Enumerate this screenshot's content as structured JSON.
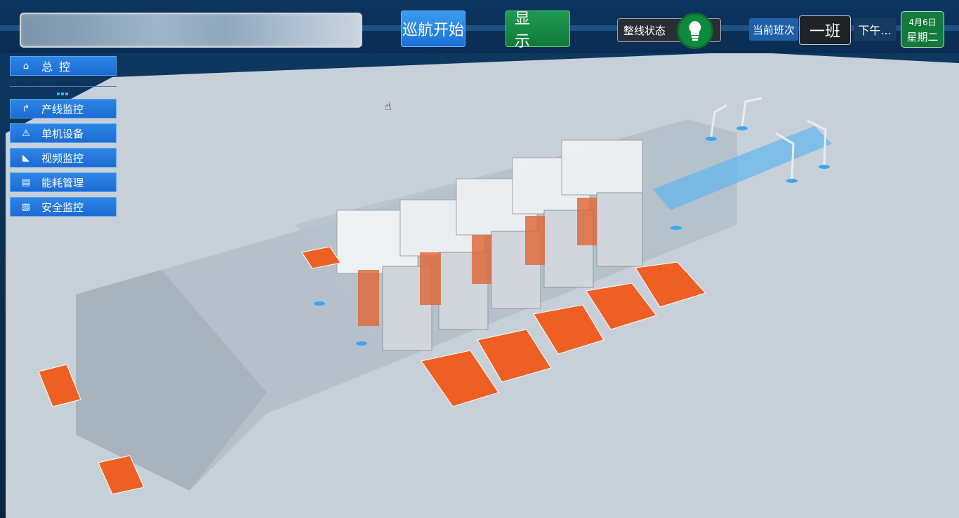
{
  "header": {
    "title": "",
    "cruise_button": "巡航开始",
    "display_button": "显 示",
    "line_status_label": "整线状态",
    "current_shift_label": "当前班次",
    "current_shift_value": "一班",
    "time_text": "下午...",
    "date": "4月6日",
    "weekday": "星期二"
  },
  "sidebar": {
    "items": [
      {
        "label": "总 控",
        "icon": "home-icon"
      },
      {
        "label": "产线监控",
        "icon": "production-line-icon"
      },
      {
        "label": "单机设备",
        "icon": "warning-icon"
      },
      {
        "label": "视频监控",
        "icon": "camera-icon"
      },
      {
        "label": "能耗管理",
        "icon": "document-icon"
      },
      {
        "label": "安全监控",
        "icon": "security-icon"
      }
    ]
  },
  "colors": {
    "accent_blue": "#1c6bd1",
    "accent_green": "#117a3a",
    "floor": "#c7d0d9",
    "machine_orange": "#e2612b"
  }
}
